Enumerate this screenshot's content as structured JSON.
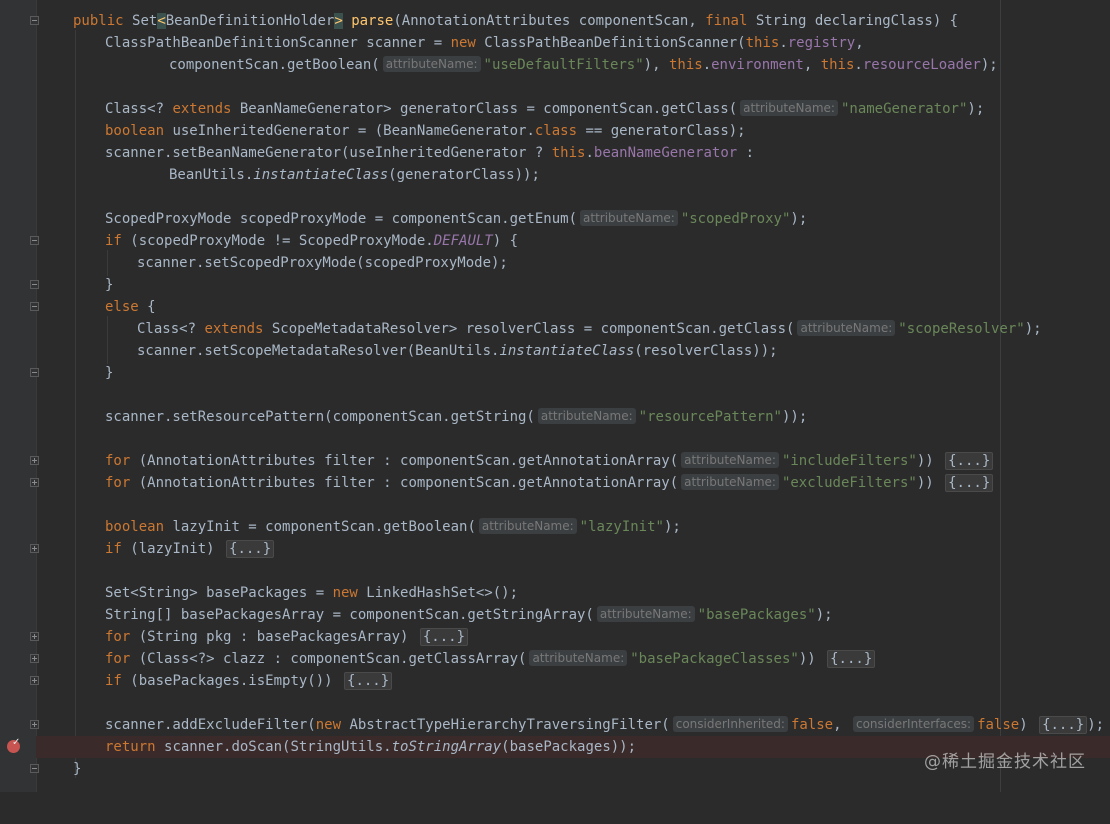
{
  "editor": {
    "lines": {
      "l1": {
        "kw1": "public ",
        "t1": "Set",
        "b1": "<",
        "t2": "BeanDefinitionHolder",
        "b2": ">",
        "t3": " ",
        "fn": "parse",
        "t4": "(AnnotationAttributes componentScan, ",
        "kw2": "final ",
        "t5": "String declaringClass) {"
      },
      "l2": {
        "t1": "ClassPathBeanDefinitionScanner scanner = ",
        "kw1": "new ",
        "t2": "ClassPathBeanDefinitionScanner(",
        "kw2": "this",
        "t3": ".",
        "f1": "registry",
        "t4": ","
      },
      "l3": {
        "t1": "componentScan.getBoolean(",
        "h1": "attributeName:",
        "s1": "\"useDefaultFilters\"",
        "t2": "), ",
        "kw1": "this",
        "t3": ".",
        "f1": "environment",
        "t4": ", ",
        "kw2": "this",
        "t5": ".",
        "f2": "resourceLoader",
        "t6": ");"
      },
      "l5": {
        "t1": "Class<? ",
        "kw1": "extends ",
        "t2": "BeanNameGenerator> generatorClass = componentScan.getClass(",
        "h1": "attributeName:",
        "s1": "\"nameGenerator\"",
        "t3": ");"
      },
      "l6": {
        "kw1": "boolean ",
        "t1": "useInheritedGenerator = (BeanNameGenerator.",
        "kw2": "class ",
        "t2": "== generatorClass);"
      },
      "l7": {
        "t1": "scanner.setBeanNameGenerator(useInheritedGenerator ? ",
        "kw1": "this",
        "t2": ".",
        "f1": "beanNameGenerator",
        "t3": " :"
      },
      "l8": {
        "t1": "BeanUtils.",
        "i1": "instantiateClass",
        "t2": "(generatorClass));"
      },
      "l10": {
        "t1": "ScopedProxyMode scopedProxyMode = componentScan.getEnum(",
        "h1": "attributeName:",
        "s1": "\"scopedProxy\"",
        "t2": ");"
      },
      "l11": {
        "kw1": "if ",
        "t1": "(scopedProxyMode != ScopedProxyMode.",
        "c1": "DEFAULT",
        "t2": ") {"
      },
      "l12": {
        "t1": "scanner.setScopedProxyMode(scopedProxyMode);"
      },
      "l13": {
        "t1": "}"
      },
      "l14": {
        "kw1": "else ",
        "t1": "{"
      },
      "l15": {
        "t1": "Class<? ",
        "kw1": "extends ",
        "t2": "ScopeMetadataResolver> resolverClass = componentScan.getClass(",
        "h1": "attributeName:",
        "s1": "\"scopeResolver\"",
        "t3": ");"
      },
      "l16": {
        "t1": "scanner.setScopeMetadataResolver(BeanUtils.",
        "i1": "instantiateClass",
        "t2": "(resolverClass));"
      },
      "l17": {
        "t1": "}"
      },
      "l19": {
        "t1": "scanner.setResourcePattern(componentScan.getString(",
        "h1": "attributeName:",
        "s1": "\"resourcePattern\"",
        "t2": "));"
      },
      "l21": {
        "kw1": "for ",
        "t1": "(AnnotationAttributes filter : componentScan.getAnnotationArray(",
        "h1": "attributeName:",
        "s1": "\"includeFilters\"",
        "t2": ")) ",
        "fold": "{...}"
      },
      "l22": {
        "kw1": "for ",
        "t1": "(AnnotationAttributes filter : componentScan.getAnnotationArray(",
        "h1": "attributeName:",
        "s1": "\"excludeFilters\"",
        "t2": ")) ",
        "fold": "{...}"
      },
      "l24": {
        "kw1": "boolean ",
        "t1": "lazyInit = componentScan.getBoolean(",
        "h1": "attributeName:",
        "s1": "\"lazyInit\"",
        "t2": ");"
      },
      "l25": {
        "kw1": "if ",
        "t1": "(lazyInit) ",
        "fold": "{...}"
      },
      "l27": {
        "t1": "Set<String> basePackages = ",
        "kw1": "new ",
        "t2": "LinkedHashSet<>();"
      },
      "l28": {
        "t1": "String[] basePackagesArray = componentScan.getStringArray(",
        "h1": "attributeName:",
        "s1": "\"basePackages\"",
        "t2": ");"
      },
      "l29": {
        "kw1": "for ",
        "t1": "(String pkg : basePackagesArray) ",
        "fold": "{...}"
      },
      "l30": {
        "kw1": "for ",
        "t1": "(Class<?> clazz : componentScan.getClassArray(",
        "h1": "attributeName:",
        "s1": "\"basePackageClasses\"",
        "t2": ")) ",
        "fold": "{...}"
      },
      "l31": {
        "kw1": "if ",
        "t1": "(basePackages.isEmpty()) ",
        "fold": "{...}"
      },
      "l33": {
        "t1": "scanner.addExcludeFilter(",
        "kw1": "new ",
        "t2": "AbstractTypeHierarchyTraversingFilter(",
        "h1": "considerInherited:",
        "kw2": "false",
        "t3": ", ",
        "h2": "considerInterfaces:",
        "kw3": "false",
        "t4": ") ",
        "fold": "{...}",
        "t5": ");"
      },
      "l34": {
        "kw1": "return ",
        "t1": "scanner.doScan(StringUtils.",
        "i1": "toStringArray",
        "t2": "(basePackages));"
      },
      "l35": {
        "t1": "}"
      }
    }
  },
  "watermark": "@稀土掘金技术社区",
  "colors": {
    "background": "#2b2b2b",
    "keyword": "#cc7832",
    "string": "#6a8759",
    "field": "#9876aa",
    "function": "#ffc66d",
    "text": "#a9b7c6",
    "breakpoint": "#c75450"
  },
  "icons": {
    "breakpoint": "breakpoint-check-icon",
    "fold": "fold-marker-icon"
  }
}
